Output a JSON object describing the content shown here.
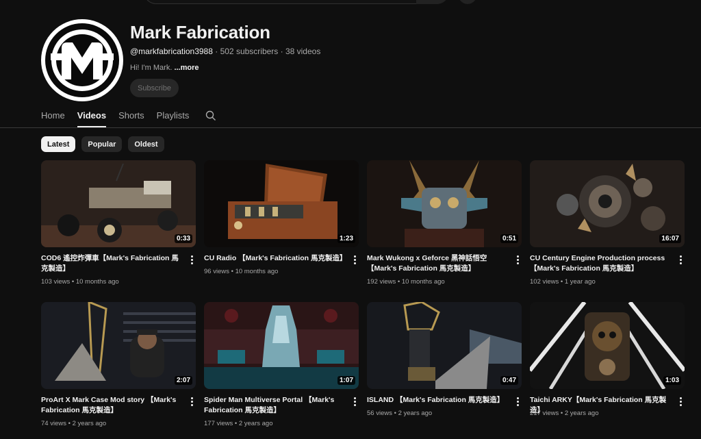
{
  "channel": {
    "name": "Mark Fabrication",
    "handle": "@markfabrication3988",
    "stats": " · 502 subscribers · 38 videos",
    "description": "Hi! I'm Mark. ",
    "more_label": "...more",
    "subscribe_label": "Subscribe"
  },
  "tabs": [
    {
      "label": "Home"
    },
    {
      "label": "Videos"
    },
    {
      "label": "Shorts"
    },
    {
      "label": "Playlists"
    }
  ],
  "active_tab": "Videos",
  "filters": [
    {
      "label": "Latest"
    },
    {
      "label": "Popular"
    },
    {
      "label": "Oldest"
    }
  ],
  "active_filter": "Latest",
  "videos": [
    {
      "title": "COD6 遙控炸彈車【Mark's Fabrication 馬克製造】",
      "meta": "103 views • 10 months ago",
      "duration": "0:33",
      "thumb_color": "#3a2a22"
    },
    {
      "title": "CU Radio 【Mark's Fabrication 馬克製造】",
      "meta": "96 views • 10 months ago",
      "duration": "1:23",
      "thumb_color": "#6b3a1e"
    },
    {
      "title": "Mark Wukong x Geforce 黑神話悟空【Mark's Fabrication 馬克製造】",
      "meta": "192 views • 10 months ago",
      "duration": "0:51",
      "thumb_color": "#2a1a14"
    },
    {
      "title": "CU Century Engine Production process 【Mark's Fabrication 馬克製造】",
      "meta": "102 views • 1 year ago",
      "duration": "16:07",
      "thumb_color": "#2c2622"
    },
    {
      "title": "ProArt X Mark Case Mod story 【Mark's Fabrication 馬克製造】",
      "meta": "74 views • 2 years ago",
      "duration": "2:07",
      "thumb_color": "#1e2128"
    },
    {
      "title": "Spider Man Multiverse Portal 【Mark's Fabrication 馬克製造】",
      "meta": "177 views • 2 years ago",
      "duration": "1:07",
      "thumb_color": "#3a1a1a"
    },
    {
      "title": "ISLAND 【Mark's Fabrication 馬克製造】",
      "meta": "56 views • 2 years ago",
      "duration": "0:47",
      "thumb_color": "#1a1c22"
    },
    {
      "title": "Taichi ARKY【Mark's Fabrication 馬克製造】",
      "meta": "217 views • 2 years ago",
      "duration": "1:03",
      "thumb_color": "#151515"
    }
  ]
}
